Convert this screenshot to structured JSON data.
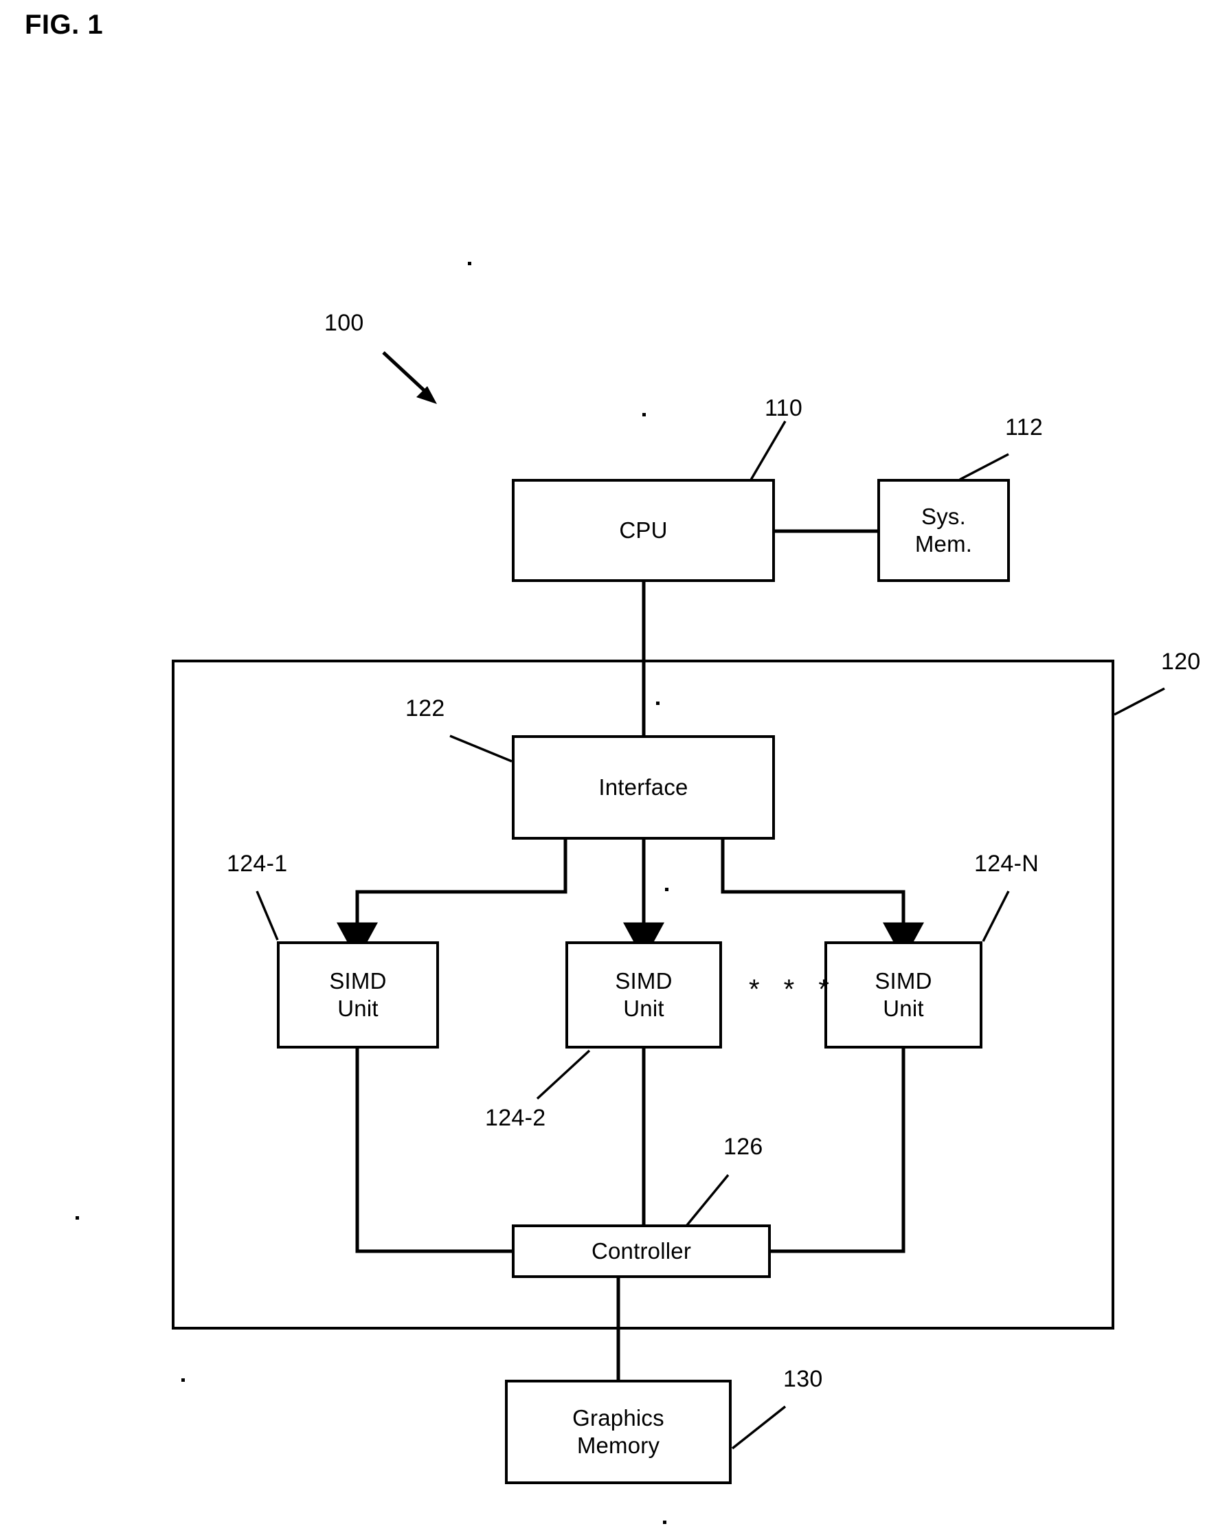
{
  "figure": {
    "title": "FIG. 1",
    "system_ref": "100"
  },
  "blocks": [
    {
      "id": "cpu",
      "label": "CPU",
      "ref": "110"
    },
    {
      "id": "system_memory",
      "label": "Sys.\nMem.",
      "ref": "112"
    },
    {
      "id": "gpu",
      "label": "",
      "ref": "120"
    },
    {
      "id": "interface",
      "label": "Interface",
      "ref": "122"
    },
    {
      "id": "simd_unit_1",
      "label": "SIMD\nUnit",
      "ref": "124-1"
    },
    {
      "id": "simd_unit_2",
      "label": "SIMD\nUnit",
      "ref": "124-2"
    },
    {
      "id": "simd_unit_n",
      "label": "SIMD\nUnit",
      "ref": "124-N"
    },
    {
      "id": "controller",
      "label": "Controller",
      "ref": "126"
    },
    {
      "id": "graphics_memory",
      "label": "Graphics\nMemory",
      "ref": "130"
    }
  ],
  "ellipsis": "* * *",
  "colors": {
    "stroke": "#000000",
    "background": "#ffffff"
  }
}
